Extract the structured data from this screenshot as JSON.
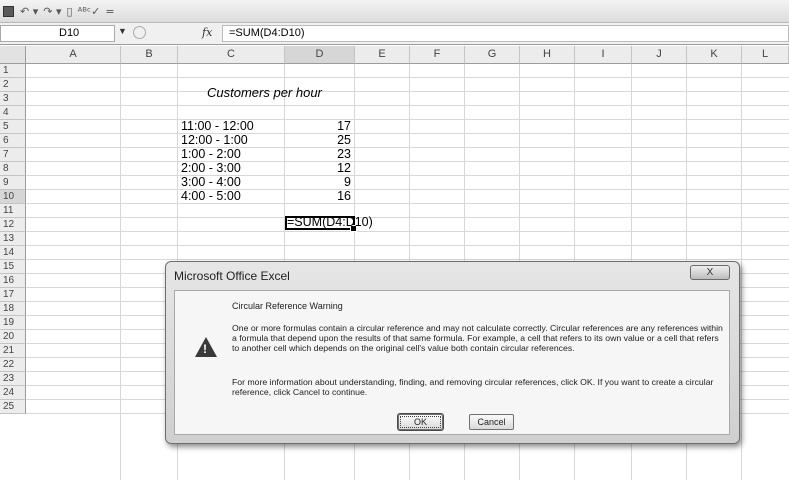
{
  "quick_access": {
    "icons": [
      "save-icon",
      "undo-icon",
      "redo-icon",
      "print-preview-icon",
      "spelling-icon",
      "customize-icon"
    ],
    "undo_glyph": "↶ ▾",
    "redo_glyph": "↷ ▾",
    "print_glyph": "▯",
    "spell_glyph": "ᴬᴮᶜ✓",
    "customize_glyph": "="
  },
  "formula_bar": {
    "name_box": "D10",
    "dropdown_glyph": "▼",
    "fx_label": "fx",
    "formula": "=SUM(D4:D10)"
  },
  "columns": [
    "A",
    "B",
    "C",
    "D",
    "E",
    "F",
    "G",
    "H",
    "I",
    "J",
    "K",
    "L"
  ],
  "rows": [
    "1",
    "2",
    "3",
    "4",
    "5",
    "6",
    "7",
    "8",
    "9",
    "10",
    "11",
    "12",
    "13",
    "14",
    "15",
    "16",
    "17",
    "18",
    "19",
    "20",
    "21",
    "22",
    "23",
    "24",
    "25"
  ],
  "selected_cell": {
    "column": "D",
    "row": "10"
  },
  "sheet": {
    "title": "Customers per hour",
    "time_slots": [
      "11:00 - 12:00",
      "12:00 - 1:00",
      "1:00 - 2:00",
      "2:00 - 3:00",
      "3:00 - 4:00",
      "4:00 - 5:00"
    ],
    "counts": [
      "17",
      "25",
      "23",
      "12",
      "9",
      "16"
    ],
    "edit_value": "=SUM(D4:D10)"
  },
  "dialog": {
    "title": "Microsoft Office Excel",
    "close_glyph": "X",
    "heading": "Circular Reference Warning",
    "paragraph1": "One or more formulas contain a circular reference and may not calculate correctly. Circular references are any references within a formula that depend upon the results of that same formula. For example, a cell that refers to its own value or a cell that refers to another cell which depends on the original cell's value both contain circular references.",
    "paragraph2": "For more information about understanding, finding, and removing circular references, click OK. If you want to create a circular reference, click Cancel to continue.",
    "ok_label": "OK",
    "cancel_label": "Cancel",
    "icon": "warning-icon"
  }
}
